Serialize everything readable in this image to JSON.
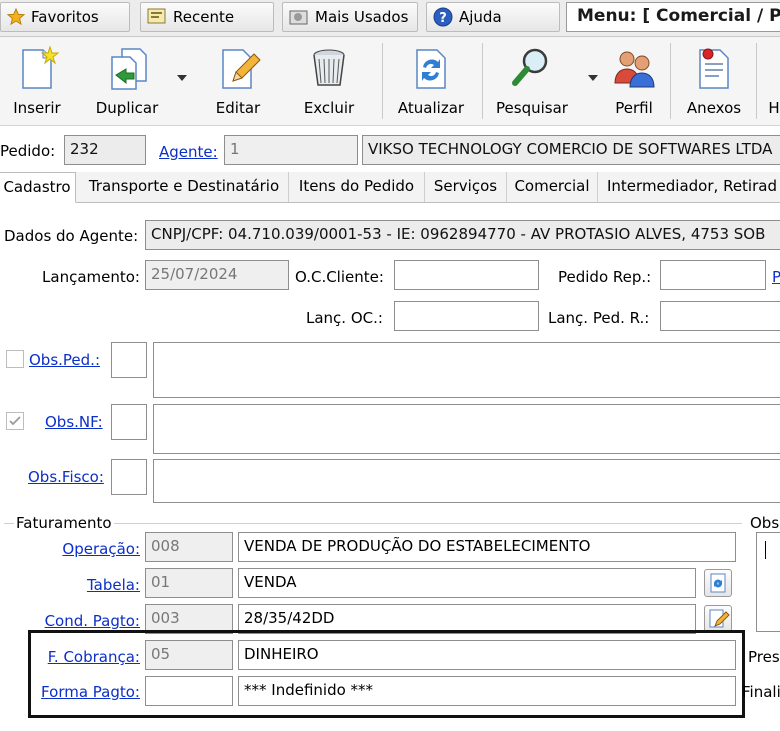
{
  "top_tabs": {
    "favoritos": "Favoritos",
    "recente": "Recente",
    "mais_usados": "Mais Usados",
    "ajuda": "Ajuda",
    "menu": "Menu: [ Comercial / P"
  },
  "toolbar": {
    "inserir": "Inserir",
    "duplicar": "Duplicar",
    "editar": "Editar",
    "excluir": "Excluir",
    "atualizar": "Atualizar",
    "pesquisar": "Pesquisar",
    "perfil": "Perfil",
    "anexos": "Anexos",
    "next": "H"
  },
  "header": {
    "pedido_label": "Pedido:",
    "pedido_value": "232",
    "agente_label": "Agente:",
    "agente_code": "1",
    "agente_name": "VIKSO TECHNOLOGY COMERCIO DE SOFTWARES LTDA"
  },
  "tabs": [
    "Cadastro",
    "Transporte e Destinatário",
    "Itens do Pedido",
    "Serviços",
    "Comercial",
    "Intermediador, Retirad"
  ],
  "cadastro": {
    "dados_agente_label": "Dados do Agente:",
    "dados_agente_value": "CNPJ/CPF: 04.710.039/0001-53 - IE: 0962894770 - AV PROTASIO ALVES, 4753 SOB",
    "lancamento_label": "Lançamento:",
    "lancamento_value": "25/07/2024",
    "oc_cliente_label": "O.C.Cliente:",
    "oc_cliente_value": "",
    "pedido_rep_label": "Pedido Rep.:",
    "pedido_rep_value": "",
    "pedido_rep_link": "P",
    "lanc_oc_label": "Lanç. OC.:",
    "lanc_oc_value": "",
    "lanc_ped_r_label": "Lanç. Ped. R.:",
    "lanc_ped_r_value": "",
    "obs_ped_label": "Obs.Ped.:",
    "obs_nf_label": "Obs.NF:",
    "obs_fisco_label": "Obs.Fisco:"
  },
  "faturamento": {
    "group_label": "Faturamento",
    "operacao_label": "Operação:",
    "operacao_code": "008",
    "operacao_desc": "VENDA DE PRODUÇÃO DO ESTABELECIMENTO",
    "tabela_label": "Tabela:",
    "tabela_code": "01",
    "tabela_desc": "VENDA",
    "cond_pagto_label": "Cond. Pagto:",
    "cond_pagto_code": "003",
    "cond_pagto_desc": "28/35/42DD",
    "f_cobranca_label": "F. Cobrança:",
    "f_cobranca_code": "05",
    "f_cobranca_desc": "DINHEIRO",
    "forma_pagto_label": "Forma Pagto:",
    "forma_pagto_code": "",
    "forma_pagto_desc": "*** Indefinido ***"
  },
  "right_panel": {
    "obs_label": "Obs",
    "pres_label": "Pres",
    "final_label": "Finali"
  },
  "colors": {
    "link": "#0b2fc9",
    "highlight_border": "#111111"
  }
}
